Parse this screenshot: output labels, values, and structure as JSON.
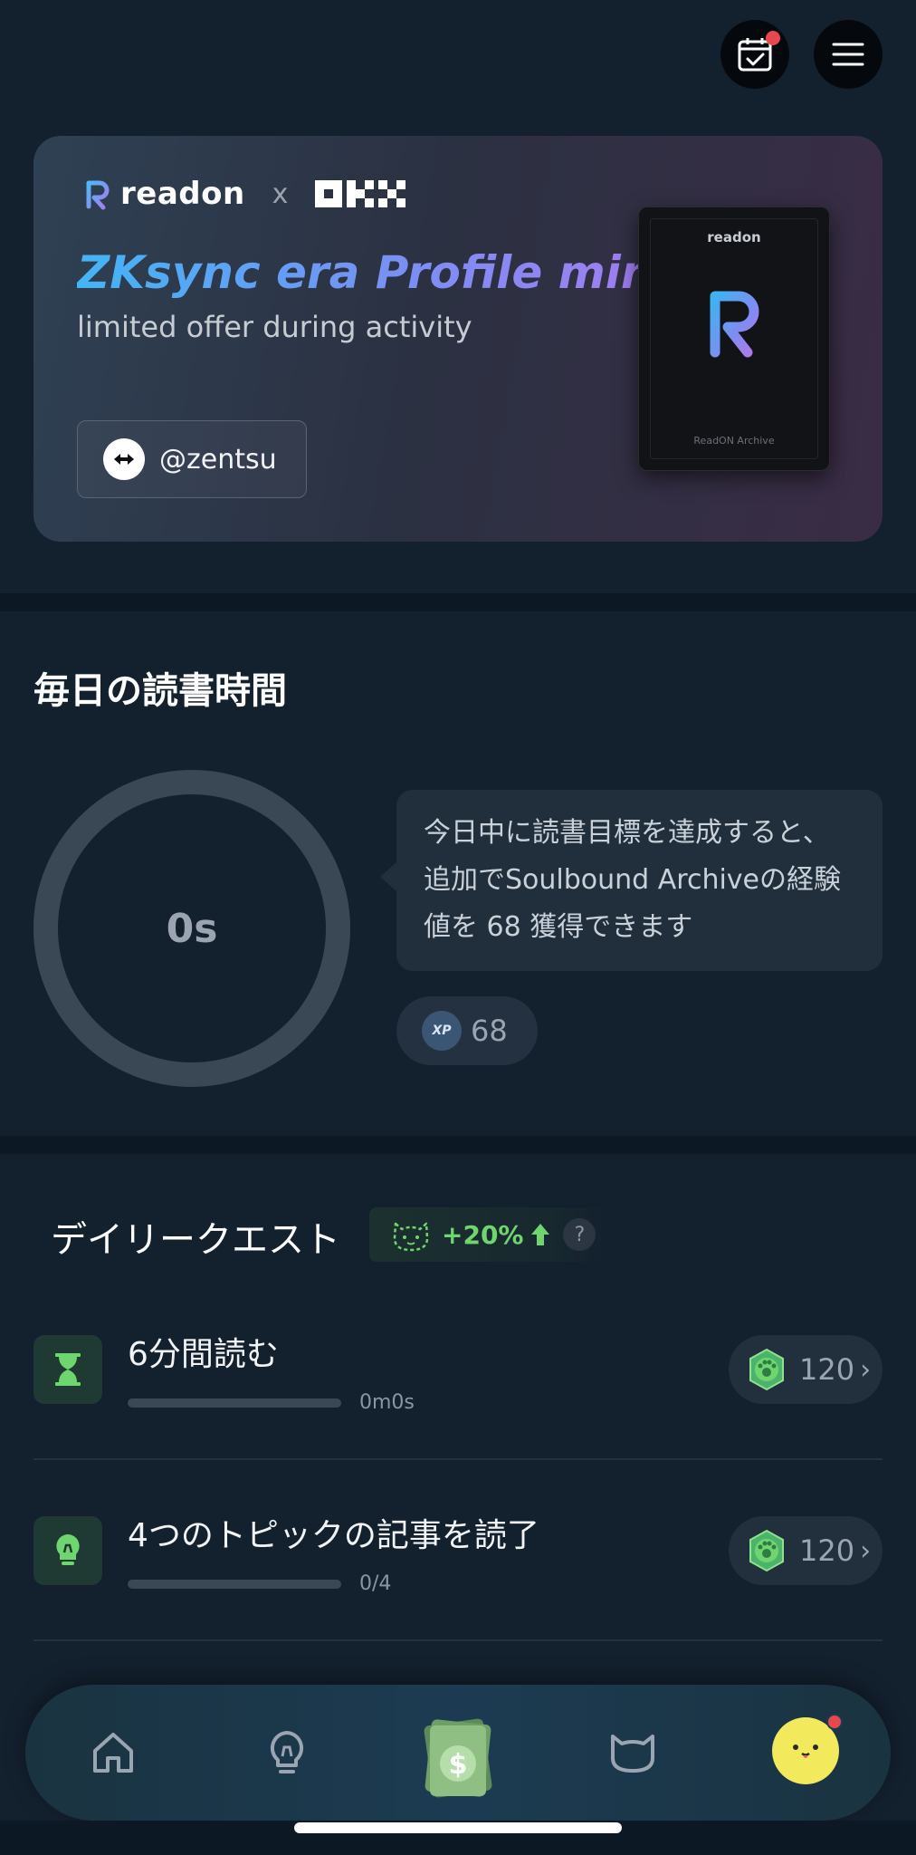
{
  "header": {
    "calendar_icon": "calendar-check-icon",
    "menu_icon": "hamburger-menu-icon"
  },
  "banner": {
    "brand": "readon",
    "separator": "x",
    "partner_logo": "OKX",
    "title": "ZKsync era Profile mint",
    "subtitle": "limited offer during activity",
    "account_handle": "@zentsu",
    "card": {
      "brand": "readon",
      "caption": "ReadON Archive"
    }
  },
  "reading": {
    "title": "毎日の読書時間",
    "elapsed": "0s",
    "progress": 0,
    "message": "今日中に読書目標を達成すると、追加でSoulbound Archiveの経験値を 68 獲得できます",
    "xp_icon_label": "XP",
    "xp_value": "68"
  },
  "quests": {
    "title": "デイリークエスト",
    "bonus": "+20%",
    "help": "?",
    "items": [
      {
        "name": "6分間読む",
        "progress_text": "0m0s",
        "progress": 0,
        "reward": "120",
        "icon": "hourglass-icon"
      },
      {
        "name": "4つのトピックの記事を読了",
        "progress_text": "0/4",
        "progress": 0,
        "reward": "120",
        "icon": "lightbulb-icon"
      }
    ]
  },
  "nav": {
    "items": [
      "home-icon",
      "lightbulb-icon",
      "money-icon",
      "cat-icon",
      "avatar"
    ],
    "money_symbol": "$"
  },
  "colors": {
    "background": "#13202e",
    "accent_green": "#6fd56f",
    "notification": "#e5484d",
    "avatar": "#f2e95c"
  }
}
